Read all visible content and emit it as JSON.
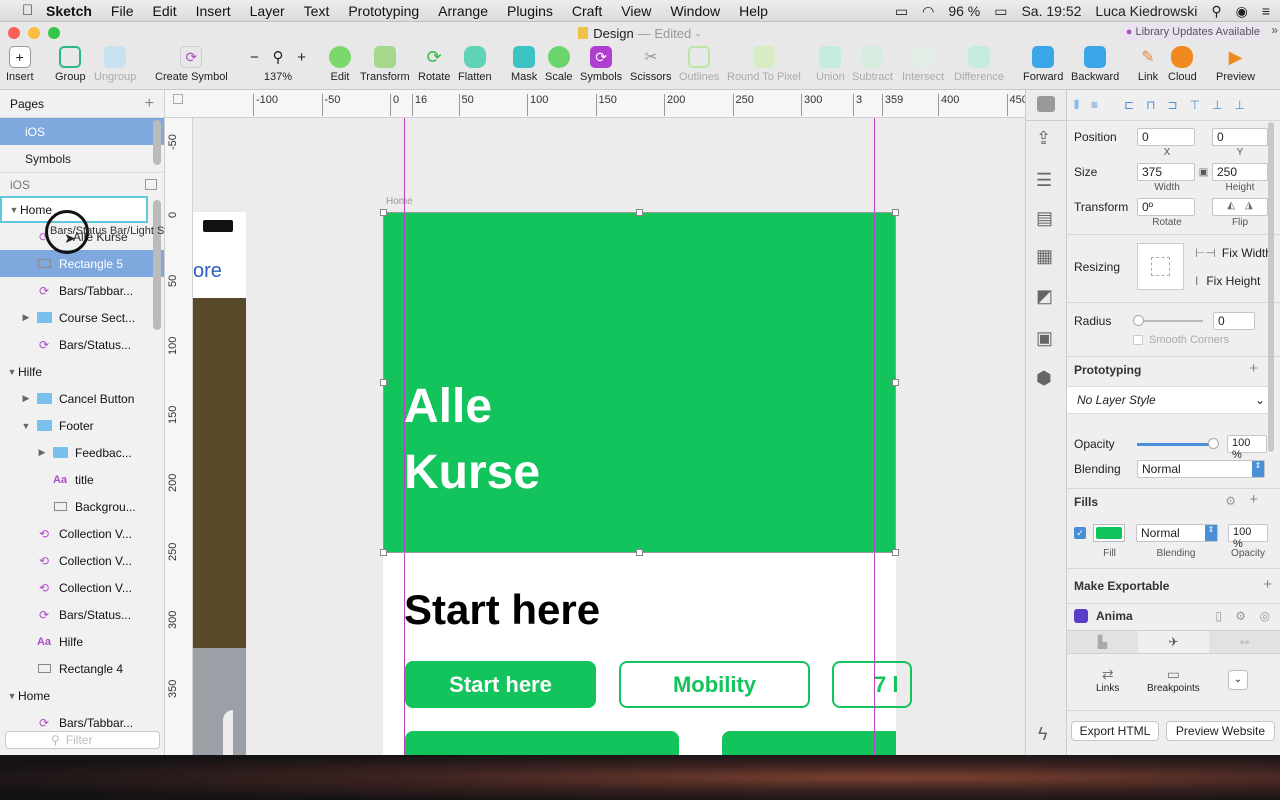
{
  "menubar": {
    "app": "Sketch",
    "items": [
      "File",
      "Edit",
      "Insert",
      "Layer",
      "Text",
      "Prototyping",
      "Arrange",
      "Plugins",
      "Craft",
      "View",
      "Window",
      "Help"
    ],
    "battery": "96 %",
    "clock": "Sa. 19:52",
    "user": "Luca Kiedrowski"
  },
  "window": {
    "doc_title": "Design",
    "doc_status": "— Edited",
    "library_notice": "Library Updates Available"
  },
  "toolbar": {
    "insert": "Insert",
    "group": "Group",
    "ungroup": "Ungroup",
    "create_symbol": "Create Symbol",
    "zoom": "137%",
    "edit": "Edit",
    "transform": "Transform",
    "rotate": "Rotate",
    "flatten": "Flatten",
    "mask": "Mask",
    "scale": "Scale",
    "symbols": "Symbols",
    "scissors": "Scissors",
    "outlines": "Outlines",
    "round_to_pixel": "Round To Pixel",
    "union": "Union",
    "subtract": "Subtract",
    "intersect": "Intersect",
    "difference": "Difference",
    "forward": "Forward",
    "backward": "Backward",
    "link": "Link",
    "cloud": "Cloud",
    "preview": "Preview"
  },
  "sidebar": {
    "pages_label": "Pages",
    "pages": [
      "iOS",
      "Symbols"
    ],
    "section": "iOS",
    "layers": [
      {
        "label": "Home",
        "indent": 0,
        "arrow": "▼",
        "icon": "none",
        "state": "editing"
      },
      {
        "label": "Alle Kurse",
        "indent": 1,
        "arrow": "",
        "icon": "symbol",
        "state": "dragging"
      },
      {
        "label": "Rectangle 5",
        "indent": 1,
        "arrow": "",
        "icon": "rect",
        "state": "selected"
      },
      {
        "label": "Bars/Tabbar...",
        "indent": 1,
        "arrow": "",
        "icon": "symbol",
        "state": ""
      },
      {
        "label": "Course Sect...",
        "indent": 1,
        "arrow": "▶",
        "icon": "folder",
        "state": ""
      },
      {
        "label": "Bars/Status...",
        "indent": 1,
        "arrow": "",
        "icon": "symbol",
        "state": ""
      },
      {
        "label": "Hilfe",
        "indent": 0,
        "arrow": "▼",
        "icon": "none",
        "state": ""
      },
      {
        "label": "Cancel Button",
        "indent": 1,
        "arrow": "▶",
        "icon": "folder",
        "state": ""
      },
      {
        "label": "Footer",
        "indent": 1,
        "arrow": "▼",
        "icon": "folder",
        "state": ""
      },
      {
        "label": "Feedbac...",
        "indent": 2,
        "arrow": "▶",
        "icon": "folder",
        "state": ""
      },
      {
        "label": "title",
        "indent": 2,
        "arrow": "",
        "icon": "text",
        "state": ""
      },
      {
        "label": "Backgrou...",
        "indent": 2,
        "arrow": "",
        "icon": "rect",
        "state": ""
      },
      {
        "label": "Collection V...",
        "indent": 1,
        "arrow": "",
        "icon": "symbol-override",
        "state": ""
      },
      {
        "label": "Collection V...",
        "indent": 1,
        "arrow": "",
        "icon": "symbol-override",
        "state": ""
      },
      {
        "label": "Collection V...",
        "indent": 1,
        "arrow": "",
        "icon": "symbol-override",
        "state": ""
      },
      {
        "label": "Bars/Status...",
        "indent": 1,
        "arrow": "",
        "icon": "symbol",
        "state": ""
      },
      {
        "label": "Hilfe",
        "indent": 1,
        "arrow": "",
        "icon": "text",
        "state": ""
      },
      {
        "label": "Rectangle 4",
        "indent": 1,
        "arrow": "",
        "icon": "rect",
        "state": ""
      },
      {
        "label": "Home",
        "indent": 0,
        "arrow": "▼",
        "icon": "none",
        "state": ""
      },
      {
        "label": "Bars/Tabbar...",
        "indent": 1,
        "arrow": "",
        "icon": "symbol",
        "state": ""
      }
    ],
    "drag_tooltip": "Bars/Status Bar/Light Status Bar",
    "filter_placeholder": "Filter"
  },
  "ruler": {
    "top": [
      "-100",
      "-50",
      "0",
      "16",
      "50",
      "100",
      "150",
      "200",
      "250",
      "300",
      "3",
      "359",
      "400",
      "450"
    ],
    "left": [
      "-50",
      "0",
      "50",
      "100",
      "150",
      "200",
      "250",
      "300",
      "350"
    ]
  },
  "canvas": {
    "artboard_label": "Home",
    "side_text": "ore",
    "hero_line1": "Alle",
    "hero_line2": "Kurse",
    "section_title": "Start here",
    "chips": [
      "Start here",
      "Mobility",
      "7 l"
    ],
    "green": "#13c35b"
  },
  "inspector": {
    "position_label": "Position",
    "x": "0",
    "y": "0",
    "x_cap": "X",
    "y_cap": "Y",
    "size_label": "Size",
    "width": "375",
    "height": "250",
    "width_cap": "Width",
    "height_cap": "Height",
    "transform_label": "Transform",
    "rotate_value": "0º",
    "rotate_cap": "Rotate",
    "flip_cap": "Flip",
    "resizing_label": "Resizing",
    "fix_width": "Fix Width",
    "fix_height": "Fix Height",
    "radius_label": "Radius",
    "radius_value": "0",
    "smooth_corners": "Smooth Corners",
    "prototyping_label": "Prototyping",
    "layer_style": "No Layer Style",
    "opacity_label": "Opacity",
    "opacity_value": "100 %",
    "opacity_level": 1.0,
    "blending_label": "Blending",
    "blending_value": "Normal",
    "fills_label": "Fills",
    "fill_blending": "Normal",
    "fill_opacity": "100 %",
    "fill_cap": "Fill",
    "fill_blending_cap": "Blending",
    "fill_opacity_cap": "Opacity",
    "exportable_label": "Make Exportable",
    "anima_label": "Anima",
    "links": "Links",
    "breakpoints": "Breakpoints",
    "export_html": "Export HTML",
    "preview_website": "Preview Website"
  }
}
